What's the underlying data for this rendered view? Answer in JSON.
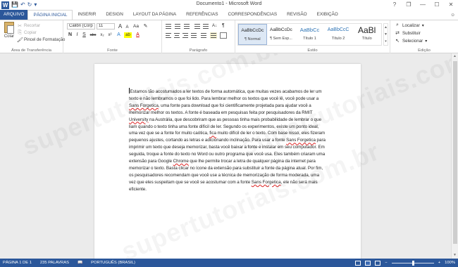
{
  "window": {
    "title": "Documento1 - Microsoft Word",
    "app_letter": "W",
    "qat": {
      "save_glyph": "💾",
      "undo_glyph": "↶",
      "redo_glyph": "↻",
      "customize_glyph": "▾"
    },
    "controls": {
      "help": "?",
      "restore": "❐",
      "minimize": "—",
      "maximize": "☐",
      "close": "✕"
    }
  },
  "tabs": [
    "ARQUIVO",
    "PÁGINA INICIAL",
    "INSERIR",
    "DESIGN",
    "LAYOUT DA PÁGINA",
    "REFERÊNCIAS",
    "CORRESPONDÊNCIAS",
    "REVISÃO",
    "EXIBIÇÃO"
  ],
  "active_tab_index": 1,
  "account": {
    "name": "",
    "glyph": "☺"
  },
  "ribbon": {
    "clipboard": {
      "label": "Área de Transferência",
      "paste": "Colar",
      "cut": "Recortar",
      "copy": "Copiar",
      "format_painter": "Pincel de Formatação"
    },
    "font": {
      "label": "Fonte",
      "font_name": "Calibri (Corp",
      "font_size": "11",
      "grow": "A",
      "shrink": "A",
      "change_case": "Aa",
      "clear": "✎",
      "bold": "N",
      "italic": "I",
      "underline": "S",
      "strike": "abc",
      "subscript": "x₂",
      "superscript": "x²",
      "text_effects": "A",
      "highlight": "ab",
      "font_color": "A"
    },
    "paragraph": {
      "label": "Parágrafo",
      "sort": "A↓",
      "show_marks": "¶"
    },
    "styles": {
      "label": "Estilo",
      "items": [
        {
          "preview": "AaBbCcDc",
          "name": "¶ Normal",
          "selected": true
        },
        {
          "preview": "AaBbCcDc",
          "name": "¶ Sem Esp..."
        },
        {
          "preview": "AaBbCc",
          "name": "Título 1"
        },
        {
          "preview": "AaBbCcC",
          "name": "Título 2"
        },
        {
          "preview": "AaBl",
          "name": "Título"
        },
        {
          "preview": "AaBbCcC",
          "name": "Subtítulo"
        }
      ]
    },
    "editing": {
      "label": "Edição",
      "find": "Localizar",
      "replace": "Substituir",
      "select": "Selecionar"
    }
  },
  "document": {
    "segments": [
      {
        "t": "Estamos tão acostumados a ler textos de forma automática, que muitas vezes acabamos de ler um texto e não lembramos o que foi lido. Para lembrar melhor os textos que você lê, você pode usar a "
      },
      {
        "t": "Sans Forgetica",
        "err": true
      },
      {
        "t": ", uma fonte para download que foi cientificamente projetada para ajudar você a memorizar melhor os textos. A fonte é baseada em pesquisas feita por pesquisadores da RMIT "
      },
      {
        "t": "University",
        "err": true
      },
      {
        "t": " na Austrália, que descobriram que as pessoas tinha mais probabilidade de lembrar o que liam quando o texto tinha uma fonte difícil de ler. Segundo os experimentos, existe um ponto ideal, uma vez que se a fonte for muito caótica, "
      },
      {
        "t": "fica",
        "err": true
      },
      {
        "t": " muito difícil de ler o texto. Com base nisso, eles fizeram pequenos ajustes, cortando as letras e adicionando inclinação. Para usar a fonte "
      },
      {
        "t": "Sans Forgetica",
        "err": true
      },
      {
        "t": " para imprimir um texto que deseja memorizar, basta você baixar a fonte e instalar em seu computador. Em seguida, troque a fonte do texto no Word ou outro programa que você usa. Eles também criaram uma extensão para Google "
      },
      {
        "t": "Chrome",
        "err": true
      },
      {
        "t": " que lhe permite trocar a letra de qualquer página da internet para memorizar o texto. Basta clicar no ícone da extensão para substituir a fonte da página atual. Por fim, os pesquisadores recomendam que você use a técnica de memorização de forma moderada, uma vez que eles suspeitam que se você se acostumar com a fonte "
      },
      {
        "t": "Sans Forgetica",
        "err": true
      },
      {
        "t": ", ele não será mais eficiente."
      }
    ]
  },
  "watermark": "supertutoriais.com.br",
  "status": {
    "page": "PÁGINA 1 DE 1",
    "words": "235 PALAVRAS",
    "proofing_icon": "📖",
    "language": "PORTUGUÊS (BRASIL)",
    "zoom_minus": "−",
    "zoom_plus": "+",
    "zoom": "100%",
    "zoom_fraction": 0.5
  },
  "colors": {
    "accent": "#2b579a",
    "spell_error": "#dd2222"
  }
}
